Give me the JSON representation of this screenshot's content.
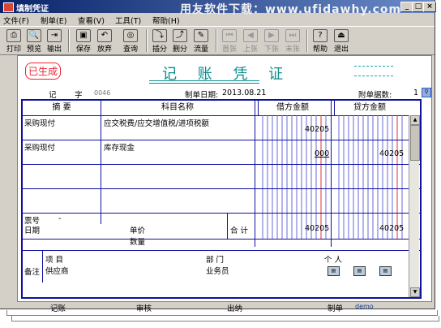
{
  "window": {
    "title": "填制凭证",
    "watermark": "用友软件下载：www.ufidawhy.com",
    "controls": [
      "_",
      "□",
      "×"
    ]
  },
  "menu": [
    "文件(F)",
    "制单(E)",
    "查看(V)",
    "工具(T)",
    "帮助(H)"
  ],
  "toolbar": [
    {
      "label": "打印",
      "icon": "printer-icon",
      "glyph": "⎙",
      "enabled": true
    },
    {
      "label": "预览",
      "icon": "preview-icon",
      "glyph": "🔍",
      "enabled": true
    },
    {
      "label": "输出",
      "icon": "export-icon",
      "glyph": "⇥",
      "enabled": true
    },
    {
      "label": "保存",
      "icon": "save-icon",
      "glyph": "▣",
      "enabled": true
    },
    {
      "label": "放弃",
      "icon": "undo-icon",
      "glyph": "↶",
      "enabled": true
    },
    {
      "label": "查询",
      "icon": "binoculars-icon",
      "glyph": "◎",
      "enabled": true
    },
    {
      "label": "插分",
      "icon": "insert-row-icon",
      "glyph": "⤵",
      "enabled": true
    },
    {
      "label": "删分",
      "icon": "delete-row-icon",
      "glyph": "⤴",
      "enabled": true
    },
    {
      "label": "流量",
      "icon": "cashflow-icon",
      "glyph": "✎",
      "enabled": true
    },
    {
      "label": "首张",
      "icon": "first-icon",
      "glyph": "⏮",
      "enabled": false
    },
    {
      "label": "上张",
      "icon": "prev-icon",
      "glyph": "◀",
      "enabled": false
    },
    {
      "label": "下张",
      "icon": "next-icon",
      "glyph": "▶",
      "enabled": false
    },
    {
      "label": "末张",
      "icon": "last-icon",
      "glyph": "⏭",
      "enabled": false
    },
    {
      "label": "帮助",
      "icon": "help-icon",
      "glyph": "?",
      "enabled": true
    },
    {
      "label": "退出",
      "icon": "exit-icon",
      "glyph": "⏏",
      "enabled": true
    }
  ],
  "voucher": {
    "status_stamp": "已生成",
    "title": "记 账 凭 证",
    "type_label": "记",
    "no_label": "字",
    "no_value": "0046",
    "date_label": "制单日期:",
    "date_value": "2013.08.21",
    "attach_label": "附单据数:",
    "attach_value": "1",
    "headers": {
      "summary": "摘 要",
      "account": "科目名称",
      "debit": "借方金额",
      "credit": "贷方金额"
    },
    "rows": [
      {
        "summary": "采购现付",
        "account": "应交税费/应交增值税/进项税额",
        "debit": "40205",
        "credit": ""
      },
      {
        "summary": "采购现付",
        "account": "库存现金",
        "debit": "000",
        "credit": "40205"
      },
      {
        "summary": "",
        "account": "",
        "debit": "",
        "credit": ""
      },
      {
        "summary": "",
        "account": "",
        "debit": "",
        "credit": ""
      }
    ],
    "footer": {
      "ticket_label": "票号",
      "ticket_value": "-",
      "date_label": "日期",
      "price_label": "单价",
      "qty_label": "数量",
      "total_label": "合 计",
      "total_debit": "40205",
      "total_credit": "40205"
    },
    "memo": {
      "label": "备注",
      "project_label": "项 目",
      "dept_label": "部 门",
      "person_label": "个 人",
      "supplier_label": "供应商",
      "salesman_label": "业务员"
    },
    "signatures": {
      "post": "记账",
      "audit": "审核",
      "cashier": "出纳",
      "maker_label": "制单",
      "maker_value": "demo"
    }
  }
}
